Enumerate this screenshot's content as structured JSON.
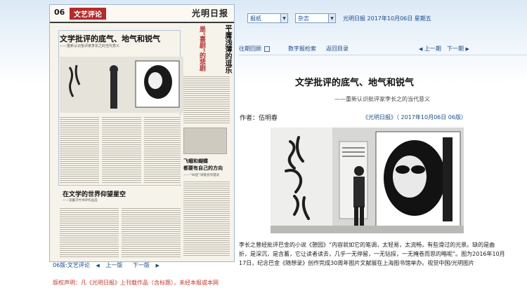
{
  "newspaper_thumb": {
    "page_number": "06",
    "section": "文艺评论",
    "logo": "光明日报",
    "main_title": "文学批评的底气、地气和锐气",
    "main_subtitle": "——重新认识批评家李长之的当代意义",
    "side_title": "平庸浅薄的逗乐",
    "side_title_red": "是“喜剧”的悲剧",
    "feiye_title": "飞蛾和蝴蝶\n都要有自己的方向",
    "feiye_subtitle": "——“90后”诗歌创作漫谈",
    "world_title": "在文学的世界仰望星空",
    "world_subtitle": "——读董子竹书评作品选"
  },
  "left_nav": {
    "page_label": "06版:文艺评论",
    "prev": "上一版",
    "next": "下一版"
  },
  "copyright": "版权声明：凡《光明日报》上刊载作品（含标题），未经本报或本网",
  "top_bar": {
    "paper_select": "报纸",
    "magazine_select": "杂志",
    "date_text": "光明日报  2017年10月06日  星期五"
  },
  "toolbar": {
    "archive": "往期回顾",
    "digital": "数字报检索",
    "back_to_list": "返回目录",
    "prev_page": "上一期",
    "next_page": "下一期"
  },
  "article": {
    "title": "文学批评的底气、地气和锐气",
    "subtitle": "——重新认识批评家李长之的当代意义",
    "author": "作者：伍明春",
    "source": "《光明日报》（ 2017年10月06日  06版）",
    "caption": "李长之曾经批评巴金的小说《憩园》“内容就如它的笔调，太轻易，太流畅，有些滑过的光景。缺的是曲折，是深沉，是含蓄，它让读者读去，几乎一无停留，一无钻探，一无掩卷而思的略呢”。图为2016年10月17日，纪念巴金《随想录》创作完成30周年图片文献展在上海图书馆举办。视觉中国/光明图片"
  }
}
